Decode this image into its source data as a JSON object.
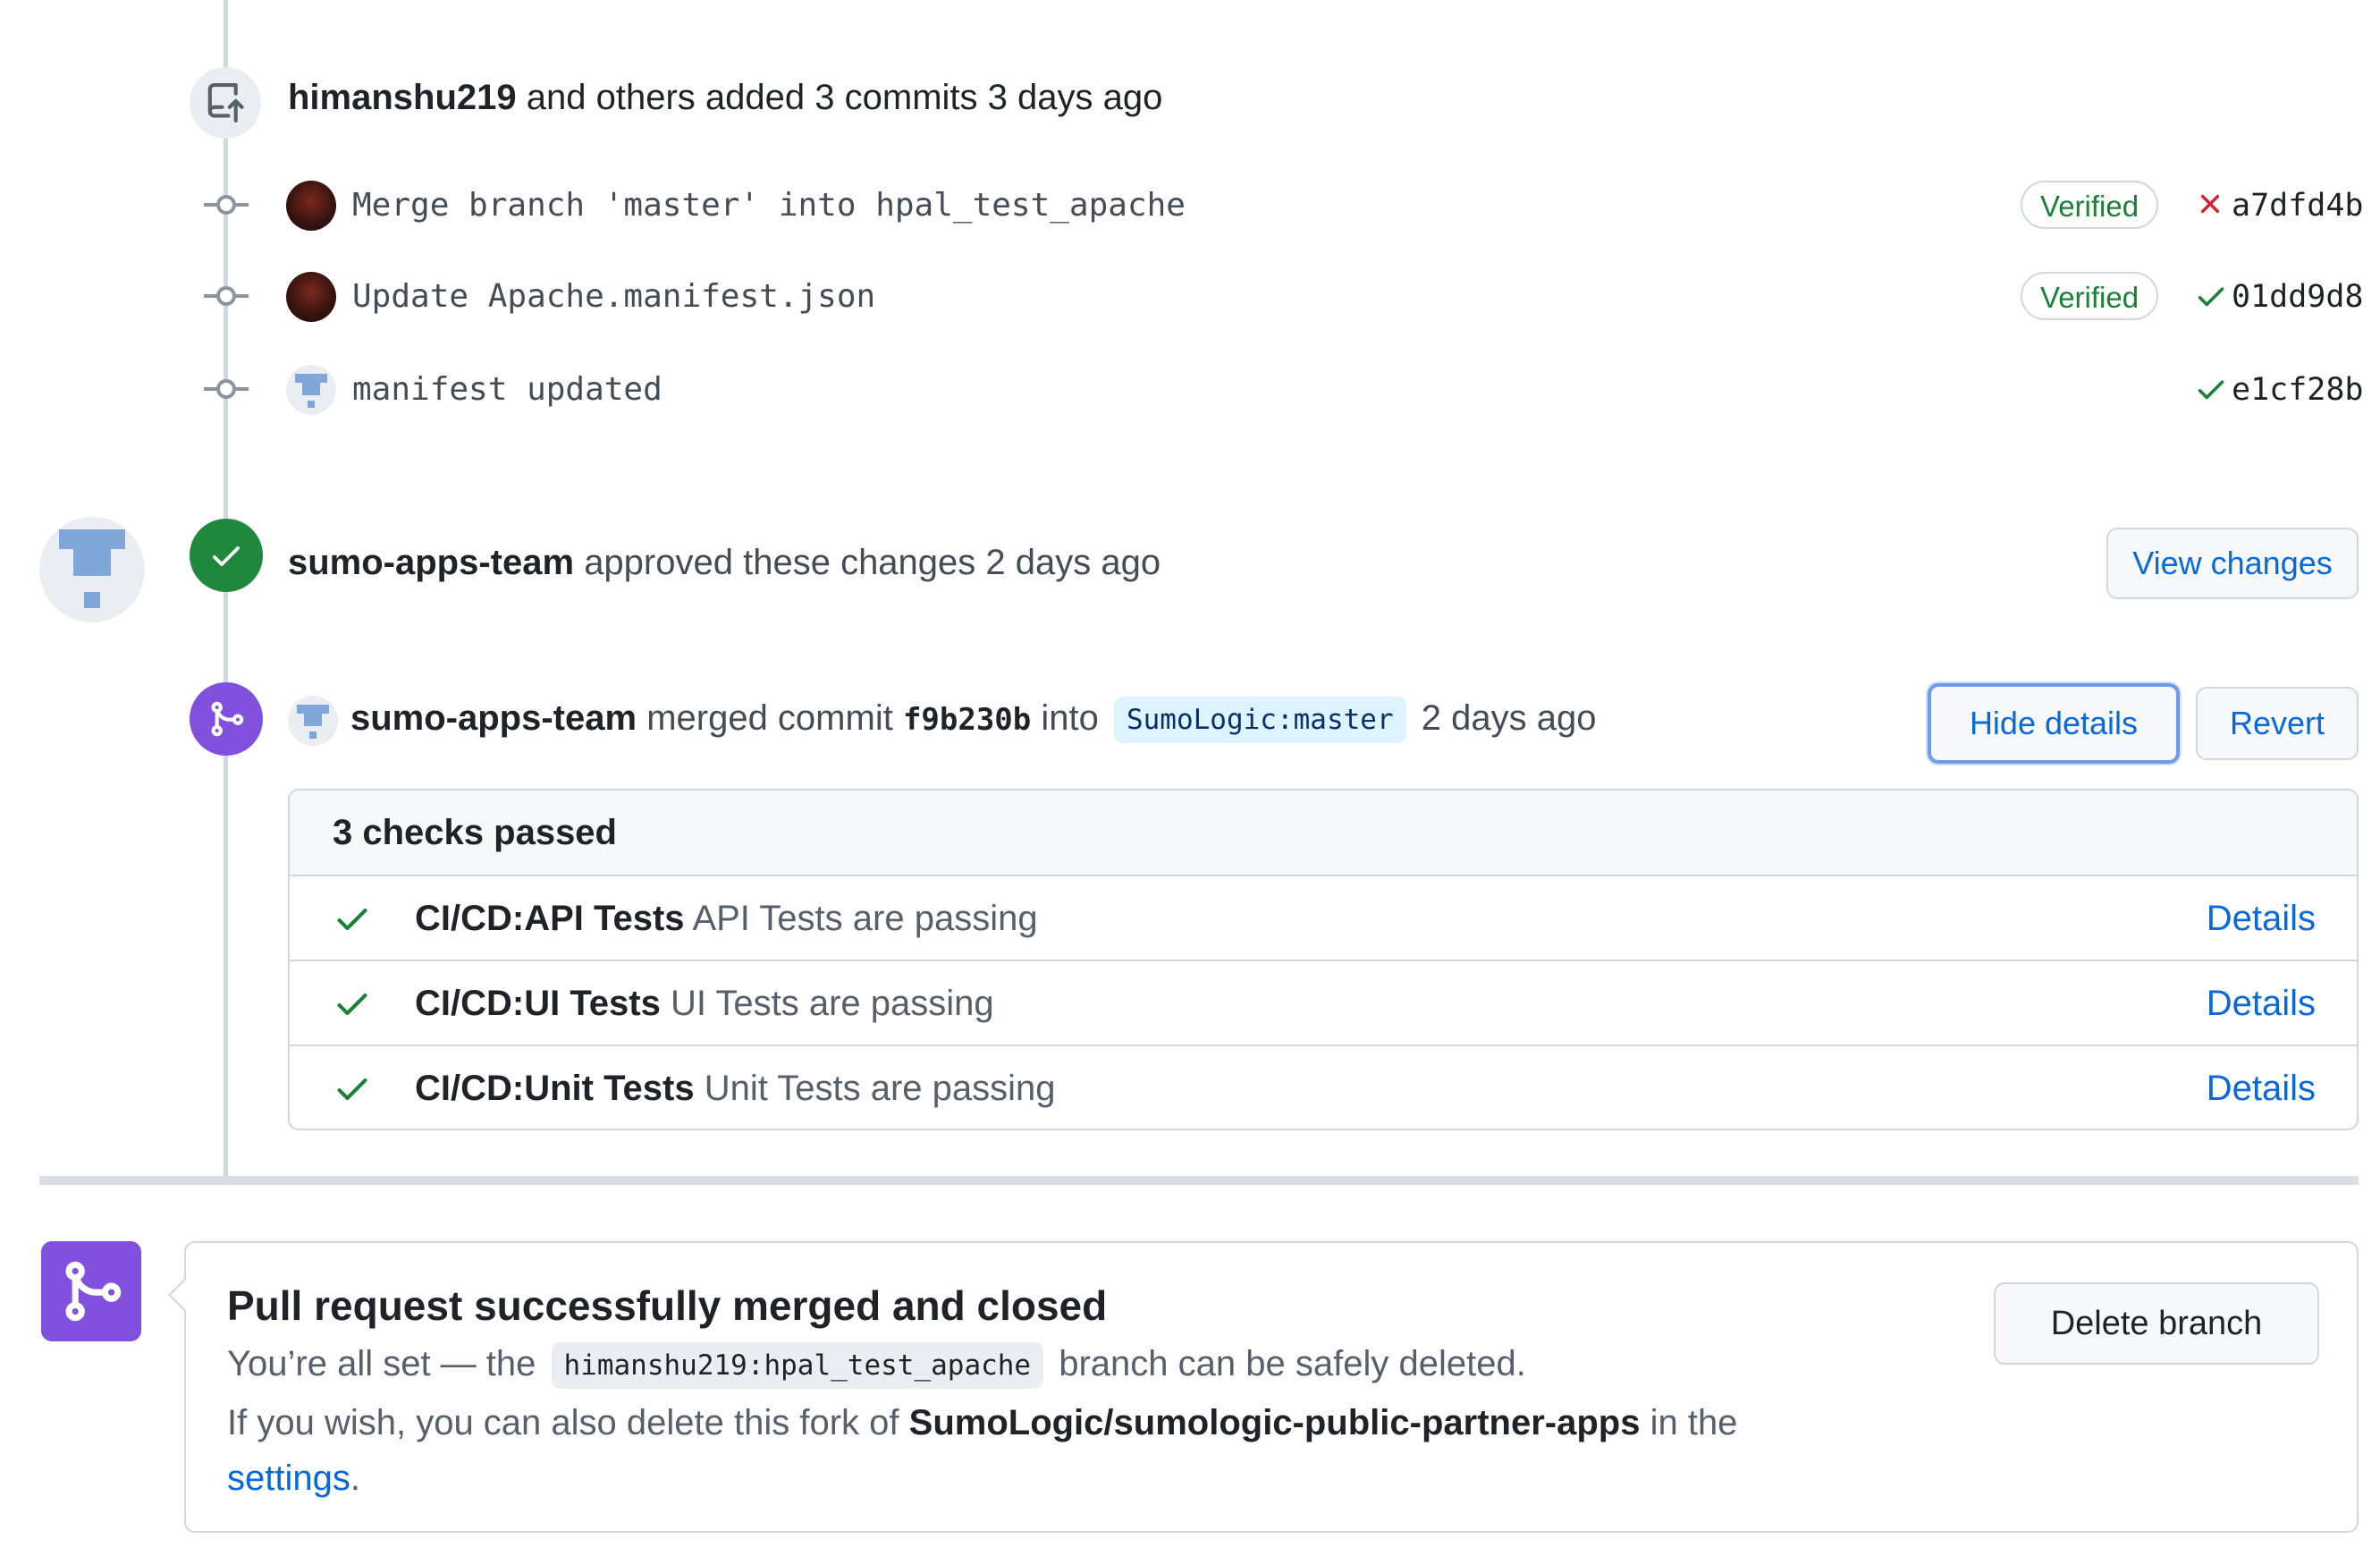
{
  "commits_header": {
    "user": "himanshu219",
    "text": "and others added 3 commits 3 days ago"
  },
  "commits": [
    {
      "message": "Merge branch 'master' into hpal_test_apache",
      "verified": "Verified",
      "status": "failed",
      "sha": "a7dfd4b"
    },
    {
      "message": "Update Apache.manifest.json",
      "verified": "Verified",
      "status": "success",
      "sha": "01dd9d8"
    },
    {
      "message": "manifest updated",
      "verified": "",
      "status": "success",
      "sha": "e1cf28b"
    }
  ],
  "approval": {
    "user": "sumo-apps-team",
    "text": "approved these changes 2 days ago",
    "view_changes_label": "View changes"
  },
  "merge_event": {
    "user": "sumo-apps-team",
    "text_merged": "merged commit",
    "commit_sha": "f9b230b",
    "text_into": "into",
    "target_branch": "SumoLogic:master",
    "time": "2 days ago",
    "hide_details_label": "Hide details",
    "revert_label": "Revert"
  },
  "checks": {
    "header": "3 checks passed",
    "items": [
      {
        "name": "CI/CD:API Tests",
        "description": "API Tests are passing",
        "details_label": "Details"
      },
      {
        "name": "CI/CD:UI Tests",
        "description": "UI Tests are passing",
        "details_label": "Details"
      },
      {
        "name": "CI/CD:Unit Tests",
        "description": "Unit Tests are passing",
        "details_label": "Details"
      }
    ]
  },
  "merged_box": {
    "title": "Pull request successfully merged and closed",
    "line1_prefix": "You’re all set — the",
    "branch": "himanshu219:hpal_test_apache",
    "line1_suffix": "branch can be safely deleted.",
    "line2_prefix": "If you wish, you can also delete this fork of",
    "repo": "SumoLogic/sumologic-public-partner-apps",
    "line2_suffix": "in the",
    "settings_link": "settings",
    "line3_suffix": ".",
    "delete_branch_label": "Delete branch"
  },
  "colors": {
    "success_green": "#1a7f37",
    "fail_red": "#cf222e",
    "merge_purple": "#8250df",
    "link_blue": "#0969da"
  },
  "icons": [
    "repo-push-icon",
    "git-commit-icon",
    "check-circle-icon",
    "git-merge-icon",
    "check-icon",
    "x-icon"
  ]
}
